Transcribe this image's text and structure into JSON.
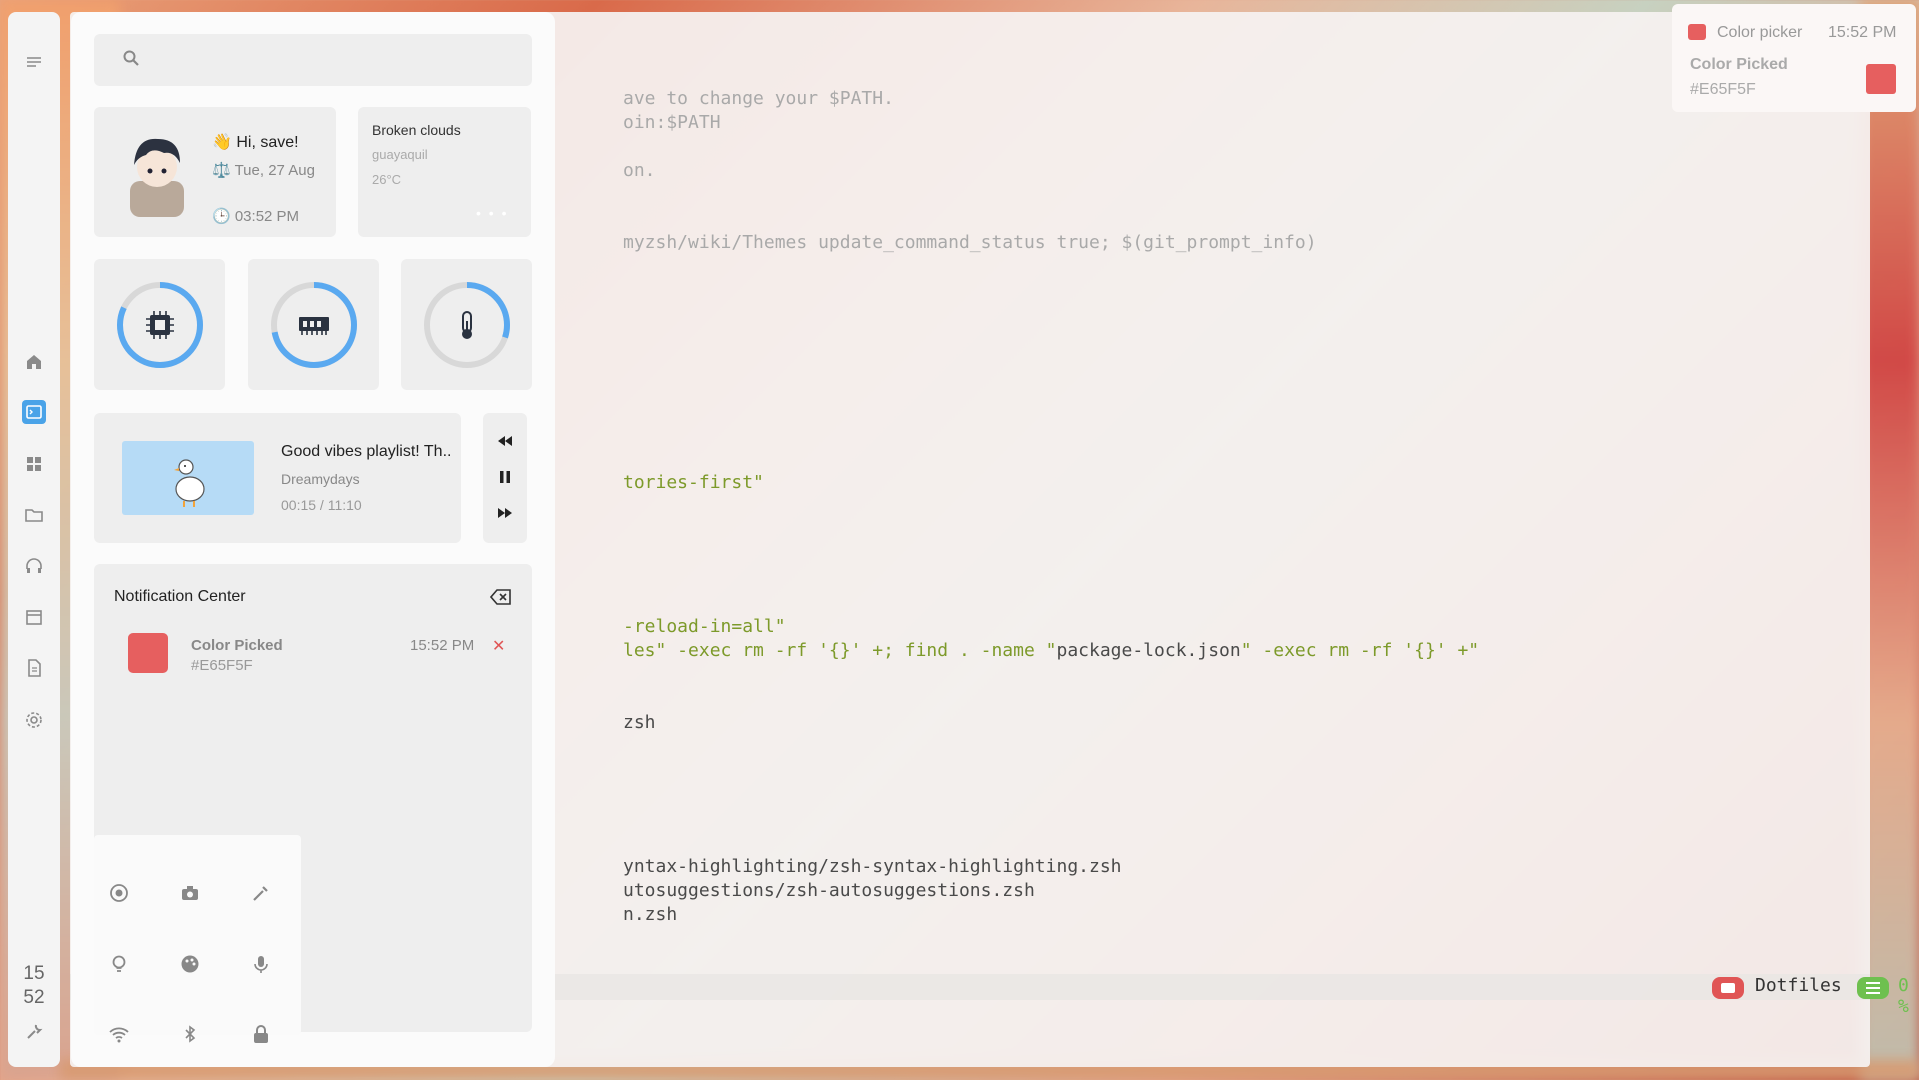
{
  "terminal": {
    "lines": [
      {
        "text": "ave to change your $PATH.",
        "cls": "c"
      },
      {
        "text": "oin:$PATH",
        "cls": "c"
      },
      {
        "text": "",
        "cls": ""
      },
      {
        "text": "on.",
        "cls": "c"
      },
      {
        "text": "",
        "cls": ""
      },
      {
        "text": "myzsh/wiki/Themes update_command_status true; $(git_prompt_info)",
        "cls": "c"
      },
      {
        "text": "tories-first\"",
        "cls": "g"
      },
      {
        "text": "-reload-in=all\"",
        "cls": "g"
      },
      {
        "text": "les\" -exec rm -rf '{}' +; find . -name \"package-lock.json\" -exec rm -rf '{}' +\"",
        "cls": "mix"
      },
      {
        "text": "zsh",
        "cls": ""
      },
      {
        "text": "yntax-highlighting/zsh-syntax-highlighting.zsh",
        "cls": ""
      },
      {
        "text": "utosuggestions/zsh-autosuggestions.zsh",
        "cls": ""
      },
      {
        "text": "n.zsh",
        "cls": ""
      }
    ],
    "statusbar": {
      "name": "Dotfiles",
      "percent": "0 %"
    }
  },
  "sidebar": {
    "clock_hour": "15",
    "clock_minute": "52",
    "icons": [
      "menu-icon",
      "home-icon",
      "terminal-icon",
      "apps-icon",
      "folder-icon",
      "headphones-icon",
      "calendar-icon",
      "document-icon",
      "settings-icon",
      "wrench-icon"
    ]
  },
  "panel": {
    "greeting": "👋 Hi, save!",
    "date": "⚖️ Tue, 27 Aug",
    "time": "🕒 03:52 PM",
    "weather": {
      "condition": "Broken clouds",
      "city": "guayaquil",
      "temp": "26°C",
      "dots": "• • •"
    },
    "gauges": [
      {
        "name": "cpu",
        "value": 0.82
      },
      {
        "name": "ram",
        "value": 0.72
      },
      {
        "name": "temperature",
        "value": 0.3
      }
    ],
    "music": {
      "title": "Good vibes playlist! Th..",
      "artist": "Dreamydays",
      "progress": "00:15 / 11:10"
    },
    "notification_center": {
      "title": "Notification Center",
      "items": [
        {
          "name": "Color Picked",
          "hex": "#E65F5F",
          "time": "15:52 PM"
        }
      ]
    }
  },
  "toast": {
    "app": "Color picker",
    "time": "15:52 PM",
    "title": "Color Picked",
    "hex": "#E65F5F"
  },
  "colors": {
    "picked": "#E65F5F",
    "accent": "#4aa3e8",
    "green": "#6ec04f"
  }
}
